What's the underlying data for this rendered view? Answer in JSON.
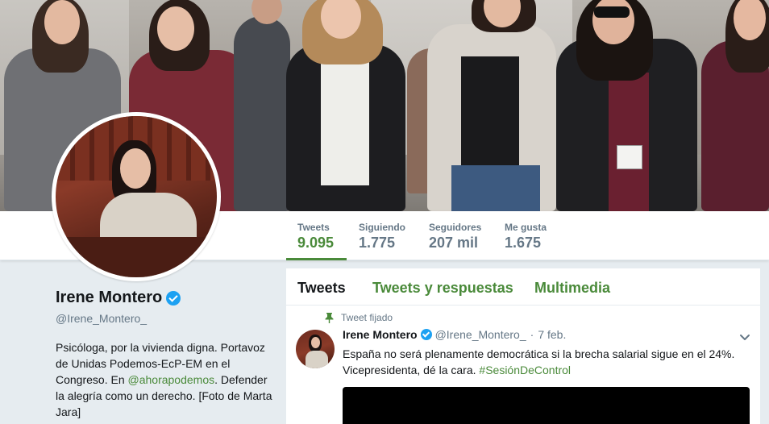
{
  "profile": {
    "name": "Irene Montero",
    "handle": "@Irene_Montero_",
    "bio_before": "Psicóloga, por la vivienda digna. Portavoz de Unidas Podemos-EcP-EM en el Congreso. En ",
    "bio_link": "@ahorapodemos",
    "bio_after": ". Defender la alegría como un derecho. [Foto de Marta Jara]"
  },
  "nav": {
    "items": [
      {
        "label": "Tweets",
        "value": "9.095"
      },
      {
        "label": "Siguiendo",
        "value": "1.775"
      },
      {
        "label": "Seguidores",
        "value": "207 mil"
      },
      {
        "label": "Me gusta",
        "value": "1.675"
      }
    ]
  },
  "timeline": {
    "tabs": [
      "Tweets",
      "Tweets y respuestas",
      "Multimedia"
    ],
    "pinned_label": "Tweet fijado",
    "tweet": {
      "name": "Irene Montero",
      "handle": "@Irene_Montero_",
      "separator": "·",
      "date": "7 feb.",
      "text_before": "España no será plenamente democrática si la brecha salarial sigue en el 24%. Vicepresidenta, dé la cara. ",
      "hashtag": "#SesiónDeControl"
    }
  },
  "colors": {
    "accent": "#4a8a3a",
    "verified": "#1da1f2",
    "muted": "#657786",
    "background": "#e6ecf0"
  },
  "icons": [
    "verified-badge-icon",
    "pin-icon",
    "chevron-down-icon"
  ]
}
